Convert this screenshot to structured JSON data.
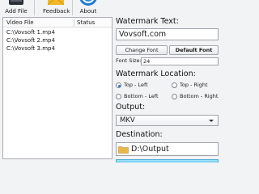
{
  "toolbar": {
    "add_file_label": "Add File",
    "feedback_label": "Feedback",
    "about_label": "About",
    "icons": [
      "film-add-icon",
      "envelope-icon",
      "info-icon"
    ]
  },
  "filelist": {
    "columns": [
      "Video File",
      "Status"
    ],
    "rows": [
      {
        "file": "C:\\Vovsoft 1.mp4",
        "status": ""
      },
      {
        "file": "C:\\Vovsoft 2.mp4",
        "status": ""
      },
      {
        "file": "C:\\Vovsoft 3.mp4",
        "status": ""
      }
    ]
  },
  "watermark": {
    "title": "Watermark Text:",
    "text_value": "Vovsoft.com",
    "change_font_label": "Change Font",
    "default_font_label": "Default Font",
    "font_size_label": "Font Size:",
    "font_size_value": "24"
  },
  "location": {
    "title": "Watermark Location:",
    "options": [
      {
        "label": "Top - Left",
        "selected": true
      },
      {
        "label": "Top - Right",
        "selected": false
      },
      {
        "label": "Bottom - Left",
        "selected": false
      },
      {
        "label": "Bottom - Right",
        "selected": false
      }
    ]
  },
  "output": {
    "title": "Output:",
    "selected": "MKV"
  },
  "destination": {
    "title": "Destination:",
    "path": "D:\\Output"
  },
  "colors": {
    "accent": "#2f6fd6",
    "start_button": "#68c6f0",
    "folder": "#e7b84a"
  }
}
